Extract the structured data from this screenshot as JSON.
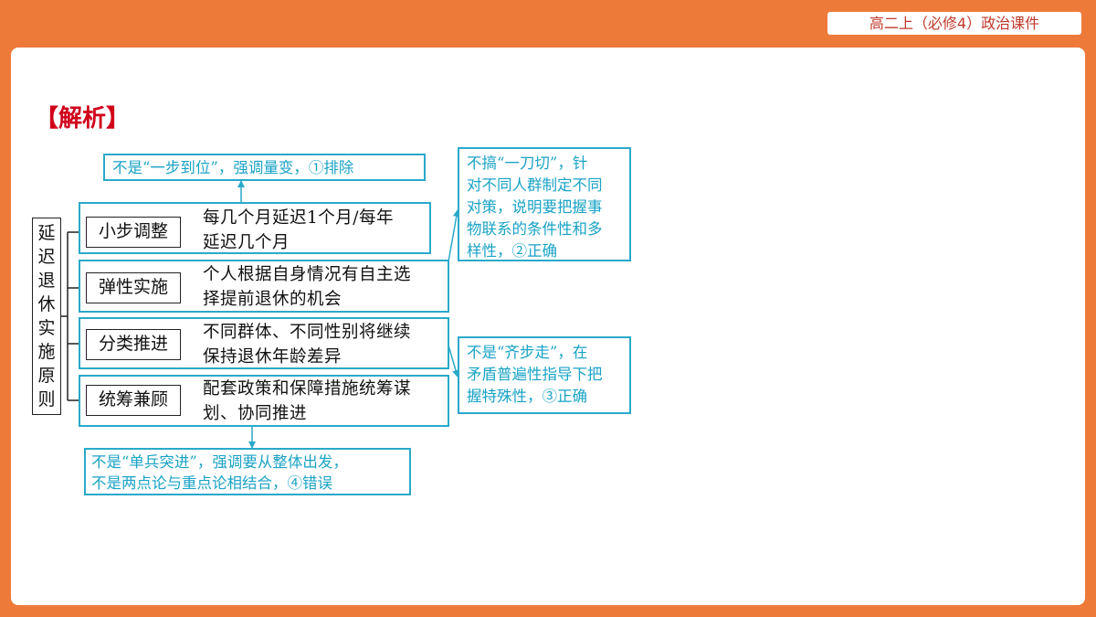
{
  "header": {
    "course_tag": "高二上（必修4）政治课件"
  },
  "section_title": "【解析】",
  "diagram": {
    "root": [
      "延",
      "迟",
      "退",
      "休",
      "实",
      "施",
      "原",
      "则"
    ],
    "branches": [
      {
        "label": "小步调整",
        "desc_line1": "每几个月延迟1个月/每年",
        "desc_line2": "延迟几个月"
      },
      {
        "label": "弹性实施",
        "desc_line1": "个人根据自身情况有自主选",
        "desc_line2": "择提前退休的机会"
      },
      {
        "label": "分类推进",
        "desc_line1": "不同群体、不同性别将继续",
        "desc_line2": "保持退休年龄差异"
      },
      {
        "label": "统筹兼顾",
        "desc_line1": "配套政策和保障措施统筹谋",
        "desc_line2": "划、协同推进"
      }
    ],
    "notes": {
      "top": "不是“一步到位”，强调量变，①排除",
      "right_top": [
        "不搞“一刀切”，针",
        "对不同人群制定不同",
        "对策，说明要把握事",
        "物联系的条件性和多",
        "样性，②正确"
      ],
      "right_bottom": [
        "不是“齐步走”，在",
        "矛盾普遍性指导下把",
        "握特殊性，③正确"
      ],
      "bottom": [
        "不是“单兵突进”，强调要从整体出发，",
        "不是两点论与重点论相结合，④错误"
      ]
    }
  },
  "colors": {
    "frame": "#ee7a3a",
    "note": "#1aa3c6",
    "title": "#d0021b"
  }
}
